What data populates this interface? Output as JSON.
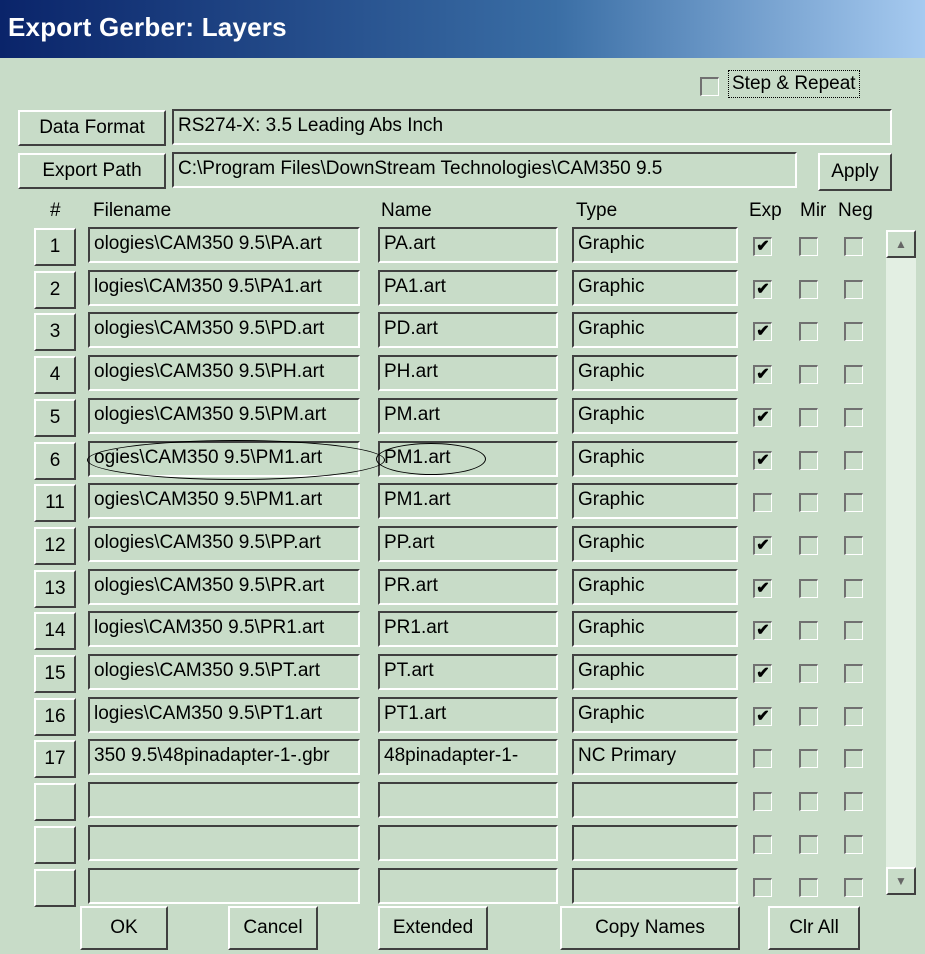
{
  "window": {
    "title": "Export Gerber: Layers"
  },
  "step_repeat": {
    "label": "Step & Repeat",
    "checked": false
  },
  "data_format": {
    "button": "Data Format",
    "value": "RS274-X: 3.5 Leading Abs Inch"
  },
  "export_path": {
    "button": "Export Path",
    "value": "C:\\Program Files\\DownStream Technologies\\CAM350 9.5",
    "apply": "Apply"
  },
  "headers": {
    "num": "#",
    "filename": "Filename",
    "name": "Name",
    "type": "Type",
    "exp": "Exp",
    "mir": "Mir",
    "neg": "Neg"
  },
  "rows": [
    {
      "num": "1",
      "filename": "ologies\\CAM350 9.5\\PA.art",
      "name": "PA.art",
      "type": "Graphic",
      "exp": true,
      "mir": false,
      "neg": false
    },
    {
      "num": "2",
      "filename": "logies\\CAM350 9.5\\PA1.art",
      "name": "PA1.art",
      "type": "Graphic",
      "exp": true,
      "mir": false,
      "neg": false
    },
    {
      "num": "3",
      "filename": "ologies\\CAM350 9.5\\PD.art",
      "name": "PD.art",
      "type": "Graphic",
      "exp": true,
      "mir": false,
      "neg": false
    },
    {
      "num": "4",
      "filename": "ologies\\CAM350 9.5\\PH.art",
      "name": "PH.art",
      "type": "Graphic",
      "exp": true,
      "mir": false,
      "neg": false
    },
    {
      "num": "5",
      "filename": "ologies\\CAM350 9.5\\PM.art",
      "name": "PM.art",
      "type": "Graphic",
      "exp": true,
      "mir": false,
      "neg": false
    },
    {
      "num": "6",
      "filename": "ogies\\CAM350 9.5\\PM1.art",
      "name": "PM1.art",
      "type": "Graphic",
      "exp": true,
      "mir": false,
      "neg": false
    },
    {
      "num": "11",
      "filename": "ogies\\CAM350 9.5\\PM1.art",
      "name": "PM1.art",
      "type": "Graphic",
      "exp": false,
      "mir": false,
      "neg": false
    },
    {
      "num": "12",
      "filename": "ologies\\CAM350 9.5\\PP.art",
      "name": "PP.art",
      "type": "Graphic",
      "exp": true,
      "mir": false,
      "neg": false
    },
    {
      "num": "13",
      "filename": "ologies\\CAM350 9.5\\PR.art",
      "name": "PR.art",
      "type": "Graphic",
      "exp": true,
      "mir": false,
      "neg": false
    },
    {
      "num": "14",
      "filename": "logies\\CAM350 9.5\\PR1.art",
      "name": "PR1.art",
      "type": "Graphic",
      "exp": true,
      "mir": false,
      "neg": false
    },
    {
      "num": "15",
      "filename": "ologies\\CAM350 9.5\\PT.art",
      "name": "PT.art",
      "type": "Graphic",
      "exp": true,
      "mir": false,
      "neg": false
    },
    {
      "num": "16",
      "filename": "logies\\CAM350 9.5\\PT1.art",
      "name": "PT1.art",
      "type": "Graphic",
      "exp": true,
      "mir": false,
      "neg": false
    },
    {
      "num": "17",
      "filename": "350 9.5\\48pinadapter-1-.gbr",
      "name": "48pinadapter-1-",
      "type": "NC Primary",
      "exp": false,
      "mir": false,
      "neg": false
    },
    {
      "num": "",
      "filename": "",
      "name": "",
      "type": "",
      "exp": false,
      "mir": false,
      "neg": false
    },
    {
      "num": "",
      "filename": "",
      "name": "",
      "type": "",
      "exp": false,
      "mir": false,
      "neg": false
    },
    {
      "num": "",
      "filename": "",
      "name": "",
      "type": "",
      "exp": false,
      "mir": false,
      "neg": false
    }
  ],
  "scrollbar": {
    "up_icon": "triangle-up",
    "down_icon": "triangle-down"
  },
  "buttons": {
    "ok": "OK",
    "cancel": "Cancel",
    "extended": "Extended",
    "copy_names": "Copy Names",
    "clr_all": "Clr All"
  }
}
